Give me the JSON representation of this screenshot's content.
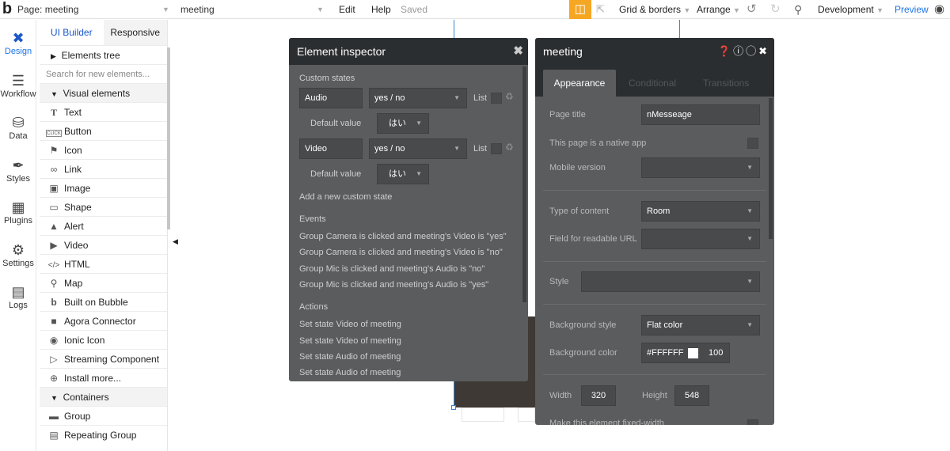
{
  "topbar": {
    "logo": "b",
    "page_prefix": "Page:",
    "page_name": "meeting",
    "element_select": "meeting",
    "edit": "Edit",
    "help": "Help",
    "saved": "Saved",
    "grid": "Grid & borders",
    "arrange": "Arrange",
    "development": "Development",
    "preview": "Preview"
  },
  "leftnav": {
    "items": [
      {
        "label": "Design",
        "icon": "design-icon"
      },
      {
        "label": "Workflow",
        "icon": "workflow-icon"
      },
      {
        "label": "Data",
        "icon": "database-icon"
      },
      {
        "label": "Styles",
        "icon": "brush-icon"
      },
      {
        "label": "Plugins",
        "icon": "plugin-icon"
      },
      {
        "label": "Settings",
        "icon": "gear-icon"
      },
      {
        "label": "Logs",
        "icon": "document-icon"
      }
    ]
  },
  "palette": {
    "tab_builder": "UI Builder",
    "tab_responsive": "Responsive",
    "elements_tree": "Elements tree",
    "search_placeholder": "Search for new elements...",
    "visual_header": "Visual elements",
    "visual": [
      "Text",
      "Button",
      "Icon",
      "Link",
      "Image",
      "Shape",
      "Alert",
      "Video",
      "HTML",
      "Map",
      "Built on Bubble",
      "Agora Connector",
      "Ionic Icon",
      "Streaming Component",
      "Install more..."
    ],
    "containers_header": "Containers",
    "containers": [
      "Group",
      "Repeating Group"
    ]
  },
  "inspector": {
    "title": "Element inspector",
    "custom_states": "Custom states",
    "state1_name": "Audio",
    "state1_type": "yes / no",
    "state2_name": "Video",
    "state2_type": "yes / no",
    "list": "List",
    "default_value": "Default value",
    "default1": "はい",
    "default2": "はい",
    "add_state": "Add a new custom state",
    "events_title": "Events",
    "events": [
      "Group Camera is clicked and meeting's Video is \"yes\"",
      "Group Camera is clicked and meeting's Video is \"no\"",
      "Group Mic is clicked and meeting's Audio is \"no\"",
      "Group Mic is clicked and meeting's Audio is \"yes\""
    ],
    "actions_title": "Actions",
    "actions": [
      "Set state Video of meeting",
      "Set state Video of meeting",
      "Set state Audio of meeting",
      "Set state Audio of meeting"
    ]
  },
  "props": {
    "title": "meeting",
    "tab_appearance": "Appearance",
    "tab_conditional": "Conditional",
    "tab_transitions": "Transitions",
    "page_title_label": "Page title",
    "page_title_value": "nMesseage",
    "native_app_label": "This page is a native app",
    "mobile_version_label": "Mobile version",
    "mobile_version_value": "",
    "type_content_label": "Type of content",
    "type_content_value": "Room",
    "readable_url_label": "Field for readable URL",
    "readable_url_value": "",
    "style_label": "Style",
    "style_value": "",
    "bg_style_label": "Background style",
    "bg_style_value": "Flat color",
    "bg_color_label": "Background color",
    "bg_color_value": "#FFFFFF",
    "bg_opacity": "100",
    "width_label": "Width",
    "width_value": "320",
    "height_label": "Height",
    "height_value": "548",
    "fixed_width_label": "Make this element fixed-width"
  },
  "colors": {
    "accent": "#1a73e8",
    "gift": "#f5a623",
    "panel_bg": "#5a5c5d",
    "panel_head": "#2b2e30"
  }
}
